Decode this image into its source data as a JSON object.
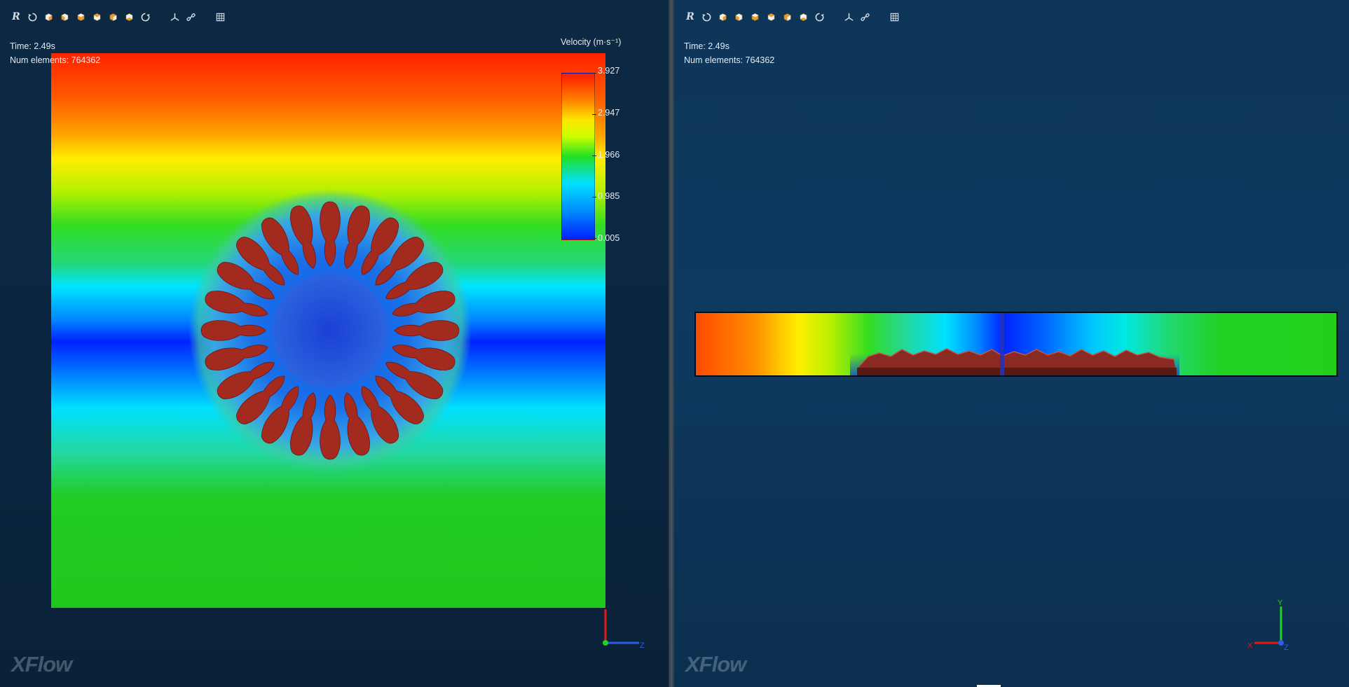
{
  "left_view": {
    "toolbar": {
      "reset_label": "R",
      "icons": [
        "reset-view-icon",
        "rotate-ccw-icon",
        "view-cube-front-icon",
        "view-cube-back-icon",
        "view-cube-left-icon",
        "view-cube-right-icon",
        "view-cube-top-icon",
        "view-cube-bottom-icon",
        "rotate-cw-icon",
        "axis-triad-icon",
        "link-icon",
        "grid-icon"
      ]
    },
    "time": "Time: 2.49s",
    "num_elements": "Num elements: 764362",
    "legend": {
      "title": "Velocity (m·s⁻¹)",
      "labels": [
        "3.927",
        "2.947",
        "1.966",
        "0.985",
        "0.005"
      ],
      "max": 3.927,
      "min": 0.005,
      "colors": [
        "#ff1a00",
        "#ff7a00",
        "#ffe600",
        "#22e022",
        "#00e0ff",
        "#0020ff"
      ]
    },
    "axes": {
      "x": "",
      "z": "Z"
    },
    "logo": "XFlow"
  },
  "right_view": {
    "toolbar": {
      "reset_label": "R",
      "icons": [
        "reset-view-icon",
        "rotate-ccw-icon",
        "view-cube-front-icon",
        "view-cube-back-icon",
        "view-cube-left-icon",
        "view-cube-right-icon",
        "view-cube-top-icon",
        "view-cube-bottom-icon",
        "rotate-cw-icon",
        "axis-triad-icon",
        "link-icon",
        "grid-icon"
      ]
    },
    "time": "Time: 2.49s",
    "num_elements": "Num elements: 764362",
    "axes": {
      "x": "X",
      "y": "Y",
      "z": "Z"
    },
    "logo": "XFlow"
  },
  "colors": {
    "particle": "#a32a1e",
    "background_left": "#0c2843",
    "background_right": "#0e3a60"
  }
}
